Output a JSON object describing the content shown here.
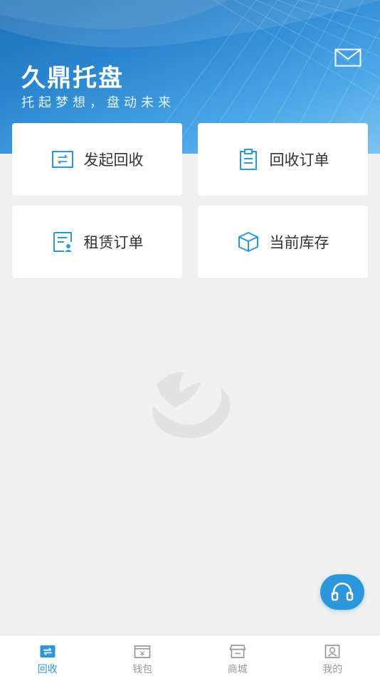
{
  "header": {
    "title": "久鼎托盘",
    "slogan": "托起梦想，盘动未来",
    "mail_icon": "mail-icon"
  },
  "menu": [
    {
      "label": "发起回收",
      "icon": "exchange-icon"
    },
    {
      "label": "回收订单",
      "icon": "clipboard-icon"
    },
    {
      "label": "租赁订单",
      "icon": "lease-document-icon"
    },
    {
      "label": "当前库存",
      "icon": "box-icon"
    }
  ],
  "support": {
    "icon": "headset-icon"
  },
  "tabbar": [
    {
      "label": "回收",
      "icon": "exchange-icon",
      "active": true
    },
    {
      "label": "钱包",
      "icon": "wallet-icon",
      "active": false
    },
    {
      "label": "商城",
      "icon": "store-icon",
      "active": false
    },
    {
      "label": "我的",
      "icon": "profile-icon",
      "active": false
    }
  ],
  "colors": {
    "accent": "#2e97dc",
    "header": "#2b86cf",
    "background": "#f0f0f0",
    "tab_inactive": "#999999"
  }
}
